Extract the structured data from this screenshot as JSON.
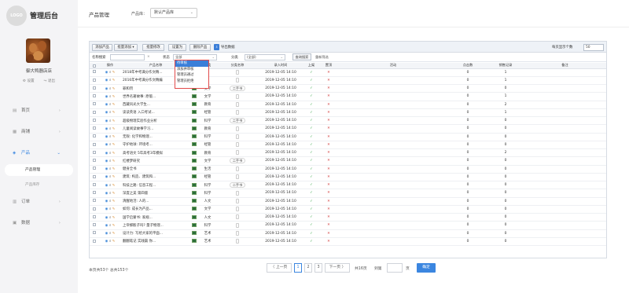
{
  "app": {
    "logo_text": "LOGO",
    "title": "管理后台"
  },
  "user": {
    "store_name": "御大鸭器店店",
    "actions": [
      "⚙ 设置",
      "↪ 退出"
    ]
  },
  "sidebar": {
    "items": [
      {
        "label": "首页",
        "icon": "dashboard-icon"
      },
      {
        "label": "商铺",
        "icon": "shop-icon"
      },
      {
        "label": "产品",
        "icon": "product-icon",
        "active": true
      },
      {
        "label": "订单",
        "icon": "order-icon"
      },
      {
        "label": "数据",
        "icon": "data-icon"
      }
    ],
    "product_sub": [
      {
        "label": "产品管理",
        "active": true
      },
      {
        "label": "产品库存"
      }
    ]
  },
  "header": {
    "page_title": "产品管理",
    "category_label": "产品库：",
    "category_value": "默认产品库"
  },
  "toolbar": {
    "buttons": [
      "添加产品",
      "批量添加 ▾",
      "批量修改",
      "设置为",
      "删除产品"
    ],
    "export_label": "导出数据",
    "pagesize_label": "每页显示个数",
    "pagesize_value": "50"
  },
  "filters": {
    "name_label": "名称搜索",
    "name_clear": "×",
    "status_label": "状态",
    "status_value": "全部",
    "category_label": "分类",
    "category_value": "(全部)",
    "search_button": "查询搜索",
    "reset_link": "重新筛选"
  },
  "status_dropdown": {
    "options": [
      "待审核",
      "添加并审核",
      "管理员通过",
      "管理员拒绝"
    ]
  },
  "table": {
    "headers": [
      "",
      "操作",
      "产品名称",
      "",
      "分类",
      "分类名称",
      "录入时间",
      "上架",
      "置顶",
      "活动",
      "点击数",
      "销售记录",
      "备注"
    ],
    "rows": [
      {
        "name": "2018年中考满分作文精...",
        "category": "",
        "cat_name": "",
        "time": "2019-12-05 14:10",
        "on": true,
        "top": true,
        "clicks": "0",
        "sales": "1"
      },
      {
        "name": "2016年中考满分作文精编",
        "category": "",
        "cat_name": "",
        "time": "2019-12-05 14:10",
        "on": true,
        "top": true,
        "clicks": "0",
        "sales": "1"
      },
      {
        "name": "罪和罚",
        "category": "文学",
        "cat_name": "二手书",
        "time": "2019-12-05 14:10",
        "on": true,
        "top": true,
        "clicks": "0",
        "sales": "0"
      },
      {
        "name": "世界名著故事: 原版...",
        "category": "文学",
        "cat_name": "",
        "time": "2019-12-05 14:10",
        "on": true,
        "top": true,
        "clicks": "0",
        "sales": "1"
      },
      {
        "name": "西藏风光大学生...",
        "category": "教育",
        "cat_name": "",
        "time": "2019-12-05 14:10",
        "on": true,
        "top": true,
        "clicks": "0",
        "sales": "2"
      },
      {
        "name": "读读英语 入口考试...",
        "category": "经管",
        "cat_name": "",
        "time": "2019-12-05 14:10",
        "on": true,
        "top": true,
        "clicks": "0",
        "sales": "1"
      },
      {
        "name": "超级物理实验作业分析",
        "category": "科学",
        "cat_name": "二手书",
        "time": "2019-12-05 14:10",
        "on": true,
        "top": true,
        "clicks": "0",
        "sales": "0"
      },
      {
        "name": "儿童阅读故事学习...",
        "category": "教育",
        "cat_name": "",
        "time": "2019-12-05 14:10",
        "on": true,
        "top": true,
        "clicks": "0",
        "sales": "0"
      },
      {
        "name": "无限: 化学和物理...",
        "category": "科学",
        "cat_name": "",
        "time": "2019-12-05 14:10",
        "on": true,
        "top": true,
        "clicks": "0",
        "sales": "0"
      },
      {
        "name": "守护地球: 环境考...",
        "category": "经管",
        "cat_name": "",
        "time": "2019-12-05 14:10",
        "on": true,
        "top": true,
        "clicks": "0",
        "sales": "0"
      },
      {
        "name": "高考语文 5年高考3年模拟",
        "category": "教育",
        "cat_name": "",
        "time": "2019-12-05 14:10",
        "on": true,
        "top": true,
        "clicks": "0",
        "sales": "2"
      },
      {
        "name": "红楼梦研究",
        "category": "文学",
        "cat_name": "二手书",
        "time": "2019-12-05 14:10",
        "on": true,
        "top": true,
        "clicks": "0",
        "sales": "0"
      },
      {
        "name": "健身全书",
        "category": "生活",
        "cat_name": "",
        "time": "2019-12-05 14:10",
        "on": true,
        "top": true,
        "clicks": "0",
        "sales": "0"
      },
      {
        "name": "建筑: 构造、建筑和...",
        "category": "经管",
        "cat_name": "",
        "time": "2019-12-05 14:10",
        "on": true,
        "top": true,
        "clicks": "0",
        "sales": "0"
      },
      {
        "name": "科技之路: 信息工程...",
        "category": "科学",
        "cat_name": "二手书",
        "time": "2019-12-05 14:10",
        "on": true,
        "top": true,
        "clicks": "0",
        "sales": "0"
      },
      {
        "name": "深度之美 第四版",
        "category": "科学",
        "cat_name": "",
        "time": "2019-12-05 14:10",
        "on": true,
        "top": true,
        "clicks": "0",
        "sales": "0"
      },
      {
        "name": "清醒地活: 人的...",
        "category": "人文",
        "cat_name": "",
        "time": "2019-12-05 14:10",
        "on": true,
        "top": true,
        "clicks": "0",
        "sales": "0"
      },
      {
        "name": "如何: 成长为产品...",
        "category": "文学",
        "cat_name": "",
        "time": "2019-12-05 14:10",
        "on": true,
        "top": true,
        "clicks": "0",
        "sales": "0"
      },
      {
        "name": "国学启蒙书: 家规...",
        "category": "人文",
        "cat_name": "",
        "time": "2019-12-05 14:10",
        "on": true,
        "top": true,
        "clicks": "0",
        "sales": "0"
      },
      {
        "name": "上帝掷骰子吗? 量子物理...",
        "category": "科学",
        "cat_name": "",
        "time": "2019-12-05 14:10",
        "on": true,
        "top": true,
        "clicks": "0",
        "sales": "0"
      },
      {
        "name": "设计力: 写给大家的平面...",
        "category": "艺术",
        "cat_name": "",
        "time": "2019-12-05 14:10",
        "on": true,
        "top": true,
        "clicks": "0",
        "sales": "0"
      },
      {
        "name": "翻翻笔记 实践篇 你...",
        "category": "艺术",
        "cat_name": "",
        "time": "2019-12-05 14:10",
        "on": true,
        "top": true,
        "clicks": "0",
        "sales": "0"
      }
    ]
  },
  "footer": {
    "info": "本页共53个 总共153个",
    "prev": "〈 上一页",
    "pages": [
      "1",
      "2",
      "3"
    ],
    "next": "下一页 〉",
    "total_pages": "共16页",
    "goto_label": "到第",
    "page_unit": "页",
    "confirm": "确定"
  }
}
